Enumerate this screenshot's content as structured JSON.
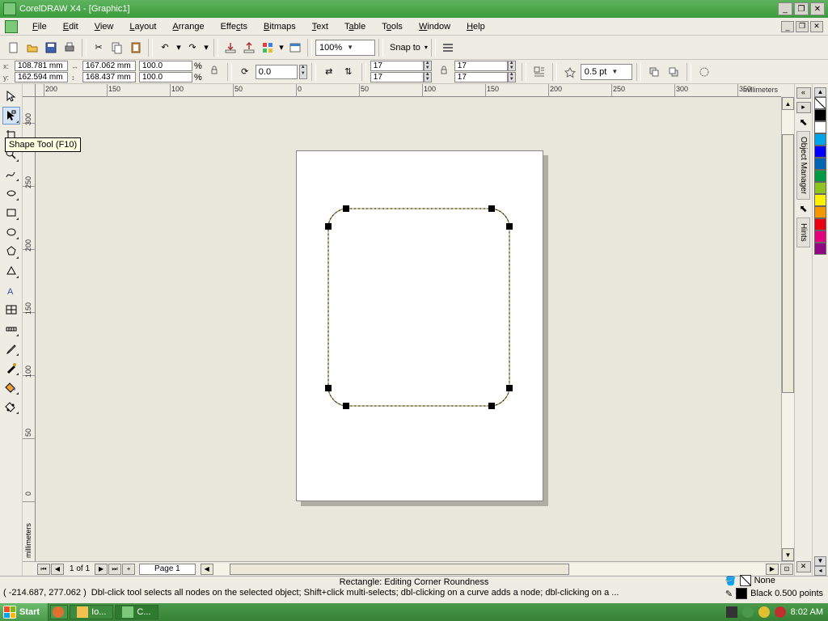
{
  "title": "CorelDRAW X4 - [Graphic1]",
  "menus": [
    "File",
    "Edit",
    "View",
    "Layout",
    "Arrange",
    "Effects",
    "Bitmaps",
    "Text",
    "Table",
    "Tools",
    "Window",
    "Help"
  ],
  "toolbar": {
    "zoom": "100%",
    "snap_label": "Snap to"
  },
  "property_bar": {
    "x_label": "x:",
    "y_label": "y:",
    "x": "108.781 mm",
    "y": "162.594 mm",
    "w_icon": "↔",
    "h_icon": "↕",
    "w": "167.062 mm",
    "h": "168.437 mm",
    "scale_x": "100.0",
    "scale_y": "100.0",
    "pct": "%",
    "rotation": "0.0",
    "corner_tl": "17",
    "corner_tr": "17",
    "corner_bl": "17",
    "corner_br": "17",
    "outline_width": "0.5 pt"
  },
  "tooltip": "Shape Tool (F10)",
  "ruler_unit_h": "millimeters",
  "ruler_unit_v": "millimeters",
  "ruler_h_labels": [
    "200",
    "150",
    "100",
    "50",
    "0",
    "50",
    "100",
    "150",
    "200",
    "250",
    "300",
    "350"
  ],
  "ruler_v_labels": [
    "300",
    "250",
    "200",
    "150",
    "100",
    "50",
    "0"
  ],
  "page_nav": {
    "info": "1 of 1",
    "tab": "Page 1"
  },
  "dockers": {
    "a": "Object Manager",
    "b": "Hints"
  },
  "status": {
    "edit_mode": "Rectangle: Editing Corner Roundness",
    "coords": "( -214.687, 277.062 )",
    "hint": "Dbl-click tool selects all nodes on the selected object; Shift+click multi-selects; dbl-clicking on a curve adds a node; dbl-clicking on a ...",
    "fill_label": "None",
    "outline_label": "Black  0.500 points"
  },
  "palette": [
    "#000000",
    "#ffffff",
    "#00a4e8",
    "#0000ff",
    "#0066b3",
    "#009944",
    "#8fc31f",
    "#fff100",
    "#f39800",
    "#e60012",
    "#e4007f",
    "#920783"
  ],
  "taskbar": {
    "start": "Start",
    "tasks": [
      "Io...",
      "C..."
    ],
    "clock": "8:02 AM"
  }
}
